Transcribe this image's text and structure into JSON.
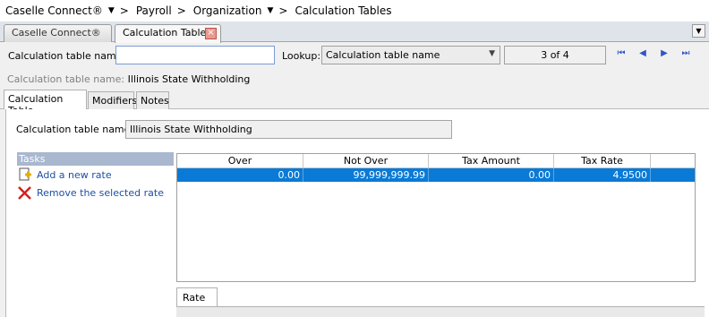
{
  "breadcrumb": {
    "items": [
      "Caselle Connect®",
      "Payroll",
      "Organization",
      "Calculation Tables"
    ]
  },
  "doc_tabs": [
    {
      "label": "Caselle Connect®"
    },
    {
      "label": "Calculation Tables"
    }
  ],
  "toolbar": {
    "name_label": "Calculation table name:",
    "name_value": "",
    "lookup_label": "Lookup:",
    "lookup_value": "Calculation table name",
    "counter": "3 of 4"
  },
  "header": {
    "label": "Calculation table name:",
    "value": "Illinois State Withholding"
  },
  "sub_tabs": [
    "Calculation Table",
    "Modifiers",
    "Notes"
  ],
  "form": {
    "name_label": "Calculation table name:",
    "name_value": "Illinois State Withholding"
  },
  "tasks": {
    "header": "Tasks",
    "items": [
      "Add a new rate",
      "Remove the selected rate"
    ]
  },
  "grid": {
    "columns": [
      "Over",
      "Not Over",
      "Tax Amount",
      "Tax Rate"
    ],
    "rows": [
      [
        "0.00",
        "99,999,999.99",
        "0.00",
        "4.9500"
      ]
    ]
  },
  "rate_tab": "Rate",
  "colors": {
    "selection": "#0a7ad6",
    "tasks_header": "#a9b7cf",
    "link": "#1e4fa3",
    "nav": "#2f55c7"
  }
}
